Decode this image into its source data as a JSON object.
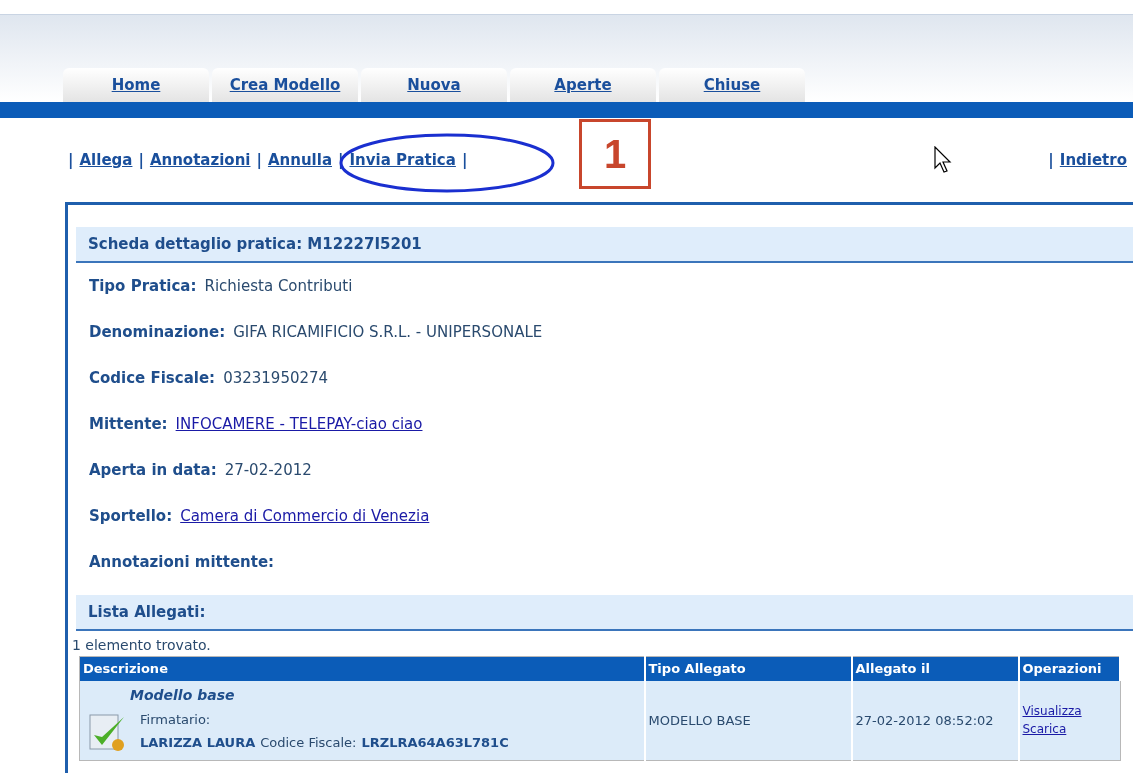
{
  "tabs": [
    {
      "label": "Home"
    },
    {
      "label": "Crea Modello"
    },
    {
      "label": "Nuova"
    },
    {
      "label": "Aperte"
    },
    {
      "label": "Chiuse"
    }
  ],
  "actions": {
    "left": [
      "Allega",
      "Annotazioni",
      "Annulla",
      "Invia Pratica"
    ],
    "right": [
      "Indietro"
    ],
    "separator": "|"
  },
  "annotation": {
    "number": "1"
  },
  "detail": {
    "title": "Scheda dettaglio pratica: M12227I5201",
    "fields": [
      {
        "label": "Tipo Pratica:",
        "value": "Richiesta Contributi",
        "kind": "text"
      },
      {
        "label": "Denominazione:",
        "value": "GIFA RICAMIFICIO S.R.L. - UNIPERSONALE",
        "kind": "text"
      },
      {
        "label": "Codice Fiscale:",
        "value": "03231950274",
        "kind": "text"
      },
      {
        "label": "Mittente:",
        "value": "INFOCAMERE - TELEPAY-ciao ciao",
        "kind": "link"
      },
      {
        "label": "Aperta in data:",
        "value": "27-02-2012",
        "kind": "text"
      },
      {
        "label": "Sportello:",
        "value": "Camera di Commercio di Venezia",
        "kind": "link"
      },
      {
        "label": "Annotazioni mittente:"
      }
    ]
  },
  "attachments": {
    "title": "Lista Allegati:",
    "count": "1 elemento trovato.",
    "columns": [
      "Descrizione",
      "Tipo Allegato",
      "Allegato il",
      "Operazioni"
    ],
    "rows": [
      {
        "name": "Modello base",
        "signer_label": "Firmatario:",
        "signer": "LARIZZA LAURA",
        "cf_label": "Codice Fiscale:",
        "cf": "LRZLRA64A63L781C",
        "type": "MODELLO BASE",
        "date": "27-02-2012 08:52:02",
        "operations": [
          "Visualizza",
          "Scarica"
        ]
      }
    ]
  }
}
